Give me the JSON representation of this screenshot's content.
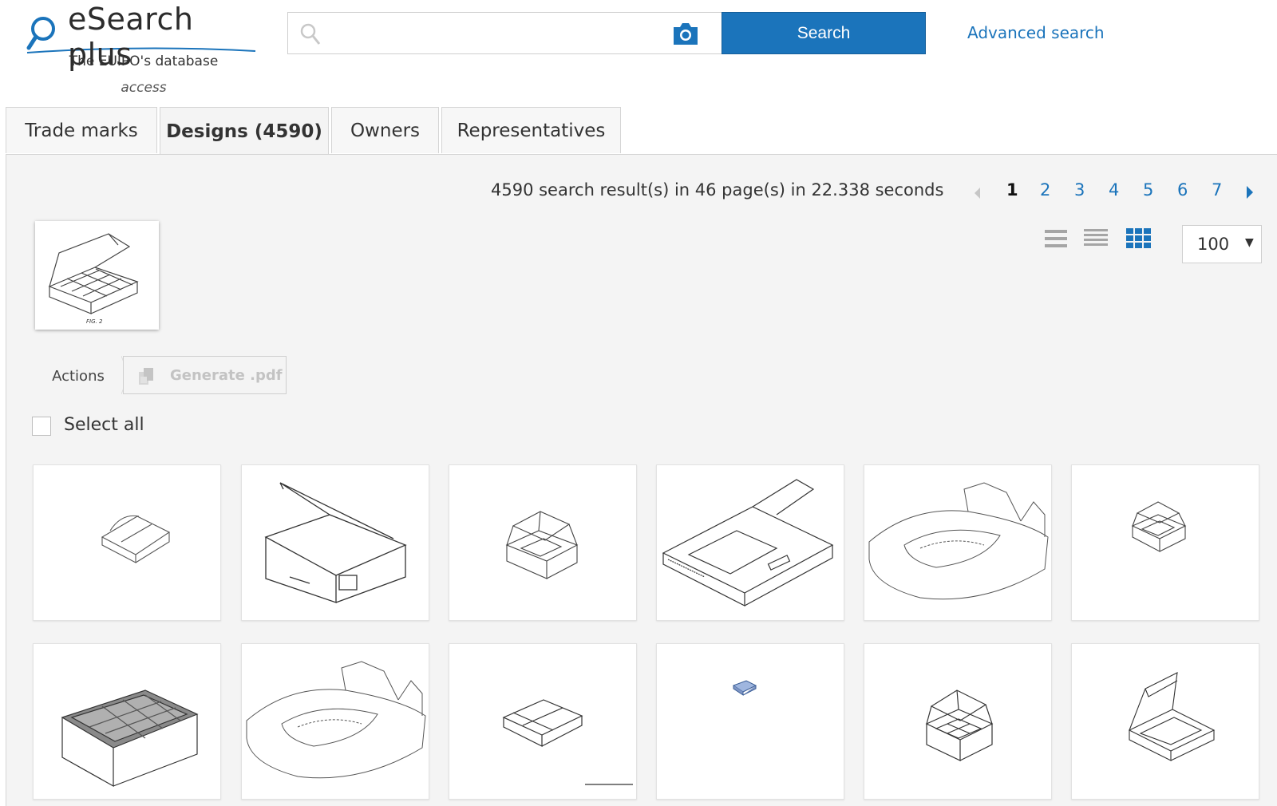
{
  "header": {
    "logo_title": "eSearch plus",
    "logo_subtitle": "The EUIPO's database",
    "logo_access": "access",
    "search_placeholder": "",
    "search_button": "Search",
    "advanced_search": "Advanced search"
  },
  "tabs": [
    {
      "label": "Trade marks"
    },
    {
      "label": "Designs (4590)"
    },
    {
      "label": "Owners"
    },
    {
      "label": "Representatives"
    }
  ],
  "results": {
    "summary": "4590 search result(s) in 46 page(s) in 22.338 seconds",
    "pages": [
      "1",
      "2",
      "3",
      "4",
      "5",
      "6",
      "7"
    ],
    "current_page": "1",
    "per_page": "100",
    "query_image_caption": "FIG. 2"
  },
  "actions": {
    "label": "Actions",
    "generate_pdf": "Generate .pdf"
  },
  "select_all": "Select all",
  "colors": {
    "accent": "#1b74bb",
    "panel_bg": "#f4f4f4"
  },
  "icons": [
    "search-icon",
    "camera-icon",
    "prev-page-icon",
    "next-page-icon",
    "list-view-icon",
    "compact-list-view-icon",
    "grid-view-icon",
    "pdf-icon"
  ]
}
